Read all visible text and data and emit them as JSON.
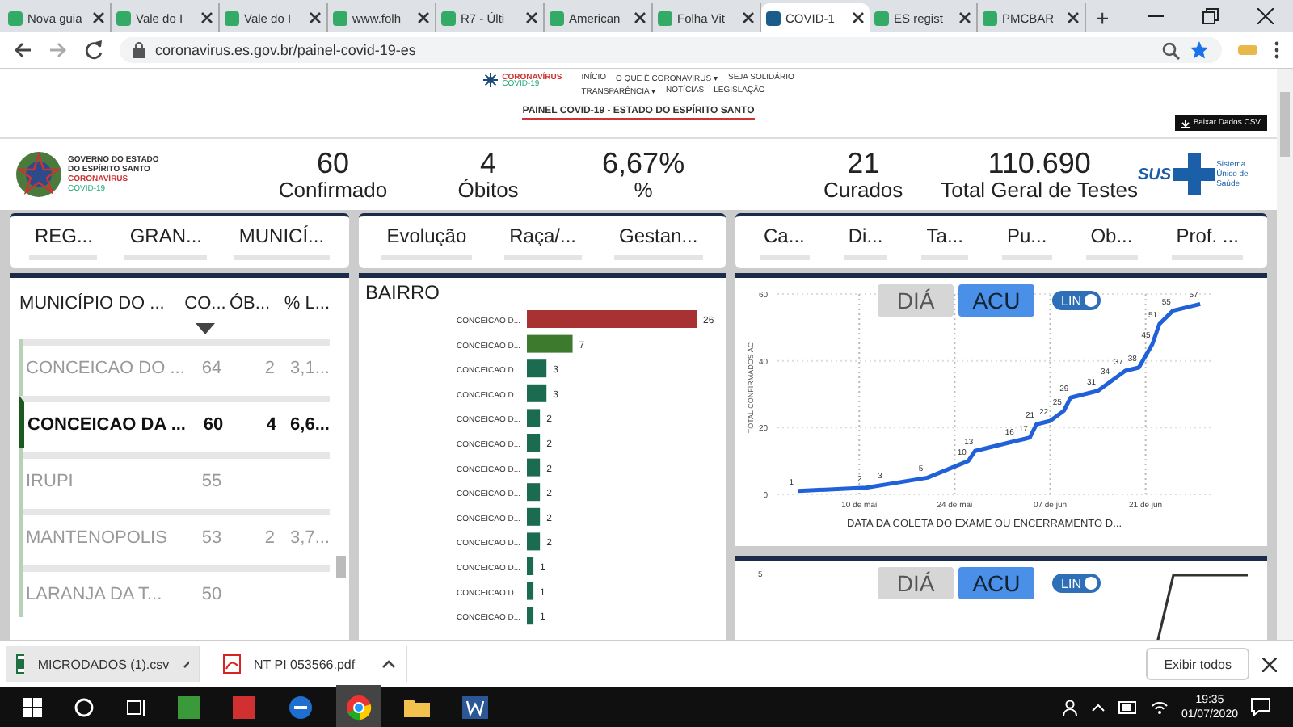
{
  "browser": {
    "tabs": [
      {
        "title": "Nova guia",
        "selected": false
      },
      {
        "title": "Vale do I",
        "selected": false
      },
      {
        "title": "Vale do I",
        "selected": false
      },
      {
        "title": "www.folh",
        "selected": false
      },
      {
        "title": "R7 - Últi",
        "selected": false
      },
      {
        "title": "American",
        "selected": false
      },
      {
        "title": "Folha Vit",
        "selected": false
      },
      {
        "title": "COVID-1",
        "selected": true
      },
      {
        "title": "ES regist",
        "selected": false
      },
      {
        "title": "PMCBAR",
        "selected": false
      }
    ],
    "new_tab": "+",
    "address": "coronavirus.es.gov.br/painel-covid-19-es"
  },
  "site_header": {
    "logo_text": "CORONAVÍRUS",
    "logo_sub": "COVID-19",
    "nav_row_1": [
      "INÍCIO",
      "O QUE É CORONAVÍRUS ▾",
      "SEJA SOLIDÁRIO"
    ],
    "nav_row_2": [
      "TRANSPARÊNCIA ▾",
      "NOTÍCIAS",
      "LEGISLAÇÃO"
    ],
    "title": "PAINEL COVID-19 - ESTADO DO ESPÍRITO SANTO",
    "download_button": "Baixar Dados CSV"
  },
  "state_logo": {
    "line_1": "GOVERNO DO ESTADO",
    "line_2": "DO ESPÍRITO SANTO",
    "line_3": "CORONAVÍRUS",
    "line_4": "COVID-19"
  },
  "sus_logo": {
    "text": "SUS",
    "subtext": "Sistema Único de Saúde"
  },
  "kpis": [
    {
      "value": "60",
      "label": "Confirmado"
    },
    {
      "value": "4",
      "label": "Óbitos"
    },
    {
      "value": "6,67%",
      "label": "%"
    },
    {
      "value": "21",
      "label": "Curados"
    },
    {
      "value": "110.690",
      "label": "Total Geral de Testes"
    }
  ],
  "slicer_groups": [
    [
      "REG...",
      "GRAN...",
      "MUNICÍ..."
    ],
    [
      "Evolução",
      "Raça/...",
      "Gestan..."
    ],
    [
      "Ca...",
      "Di...",
      "Ta...",
      "Pu...",
      "Ob...",
      "Prof. ..."
    ]
  ],
  "table": {
    "columns": [
      "MUNICÍPIO DO ...",
      "CO...",
      "ÓB...",
      "% L..."
    ],
    "rows": [
      {
        "cells": [
          "CONCEICAO DO ...",
          "64",
          "2",
          "3,1..."
        ],
        "selected": false
      },
      {
        "cells": [
          "CONCEICAO DA ...",
          "60",
          "4",
          "6,6..."
        ],
        "selected": true
      },
      {
        "cells": [
          "IRUPI",
          "55",
          "",
          ""
        ],
        "selected": false
      },
      {
        "cells": [
          "MANTENOPOLIS",
          "53",
          "2",
          "3,7..."
        ],
        "selected": false
      },
      {
        "cells": [
          "LARANJA DA T...",
          "50",
          "",
          ""
        ],
        "selected": false
      }
    ]
  },
  "bairro_panel": {
    "title": "BAIRRO",
    "chart_data": {
      "type": "bar",
      "orientation": "horizontal",
      "data_labels": true,
      "categories": [
        "CONCEICAO D...",
        "CONCEICAO D...",
        "CONCEICAO D...",
        "CONCEICAO D...",
        "CONCEICAO D...",
        "CONCEICAO D...",
        "CONCEICAO D...",
        "CONCEICAO D...",
        "CONCEICAO D...",
        "CONCEICAO D...",
        "CONCEICAO D...",
        "CONCEICAO D...",
        "CONCEICAO D..."
      ],
      "series": [
        {
          "color": "#a83232",
          "values": [
            26,
            null,
            null,
            null,
            null,
            null,
            null,
            null,
            null,
            null,
            null,
            null,
            null
          ]
        },
        {
          "color": "#3d7a2e",
          "values": [
            null,
            7,
            null,
            null,
            null,
            null,
            null,
            null,
            null,
            null,
            null,
            null,
            null
          ]
        },
        {
          "color": "#1a6b4f",
          "values": [
            null,
            null,
            3,
            3,
            2,
            2,
            2,
            2,
            2,
            2,
            1,
            1,
            1
          ]
        }
      ]
    }
  },
  "line_panels": [
    {
      "toggles": [
        {
          "label": "DIÁ",
          "selected": false
        },
        {
          "label": "ACU",
          "selected": true
        }
      ],
      "switch": {
        "label": "LIN",
        "on": true
      },
      "chart_data": {
        "type": "line",
        "xlabel": "DATA DA COLETA DO EXAME OU ENCERRAMENTO D...",
        "ylabel": "TOTAL CONFIRMADOS AC",
        "data_labels": true,
        "grid": true,
        "x": [
          1,
          11,
          14,
          20,
          26,
          27,
          33,
          35,
          36,
          38,
          40,
          41,
          45,
          47,
          49,
          51,
          53,
          54,
          56,
          60
        ],
        "xlim": [
          -2,
          62
        ],
        "ylim": [
          0,
          60
        ],
        "yticks": [
          0,
          20,
          40,
          60
        ],
        "xticks": [
          {
            "value": 10,
            "label": "10 de mai"
          },
          {
            "value": 24,
            "label": "24 de mai"
          },
          {
            "value": 38,
            "label": "07 de jun"
          },
          {
            "value": 52,
            "label": "21 de jun"
          }
        ],
        "series": [
          {
            "color": "#2060d8",
            "values": [
              1,
              2,
              3,
              5,
              10,
              13,
              16,
              17,
              21,
              22,
              25,
              29,
              31,
              34,
              37,
              38,
              45,
              51,
              55,
              57
            ]
          }
        ]
      }
    },
    {
      "toggles": [
        {
          "label": "DIÁ",
          "selected": false
        },
        {
          "label": "ACU",
          "selected": true
        }
      ],
      "switch": {
        "label": "LIN",
        "on": true
      },
      "top_tick": "5"
    }
  ],
  "downloads": {
    "files": [
      {
        "name": "MICRODADOS (1).csv",
        "kind": "csv"
      },
      {
        "name": "NT PI 053566.pdf",
        "kind": "pdf"
      }
    ],
    "show_all": "Exibir todos"
  },
  "taskbar": {
    "time": "19:35",
    "date": "01/07/2020"
  }
}
